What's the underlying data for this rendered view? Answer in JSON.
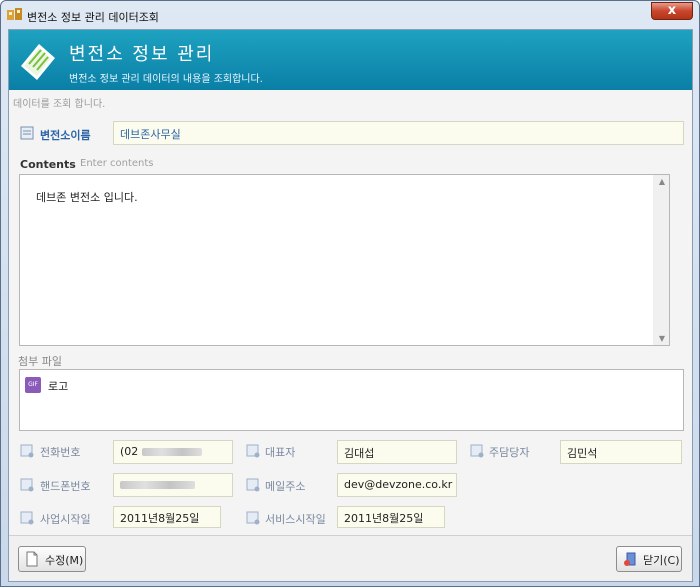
{
  "window": {
    "title": "변전소 정보 관리 데이터조회",
    "close_glyph": "x"
  },
  "banner": {
    "title": "변전소 정보 관리",
    "subtitle": "변전소 정보 관리 데이터의 내용을 조회합니다."
  },
  "status_text": "데이터를 조회 합니다.",
  "substation": {
    "label": "변전소이름",
    "value": "데브존사무실"
  },
  "contents": {
    "label": "Contents",
    "hint": "Enter contents",
    "text": "데브존 변전소 입니다."
  },
  "attachments": {
    "label": "첨부 파일",
    "items": [
      {
        "icon": "gif-file-icon",
        "badge": "GIF",
        "name": "로고"
      }
    ]
  },
  "fields": {
    "phone": {
      "label": "전화번호",
      "value_prefix": "(02"
    },
    "representative": {
      "label": "대표자",
      "value": "김대섭"
    },
    "manager": {
      "label": "주담당자",
      "value": "김민석"
    },
    "mobile": {
      "label": "핸드폰번호",
      "value_prefix": ""
    },
    "email": {
      "label": "메일주소",
      "value": "dev@devzone.co.kr"
    },
    "business_start": {
      "label": "사업시작일",
      "value": "2011년8월25일"
    },
    "service_start": {
      "label": "서비스시작일",
      "value": "2011년8월25일"
    }
  },
  "buttons": {
    "edit": "수정(M)",
    "close": "닫기(C)"
  },
  "colors": {
    "banner": "#0a7fa6",
    "label_blue": "#2a63a6",
    "input_bg": "#fbfbee"
  }
}
